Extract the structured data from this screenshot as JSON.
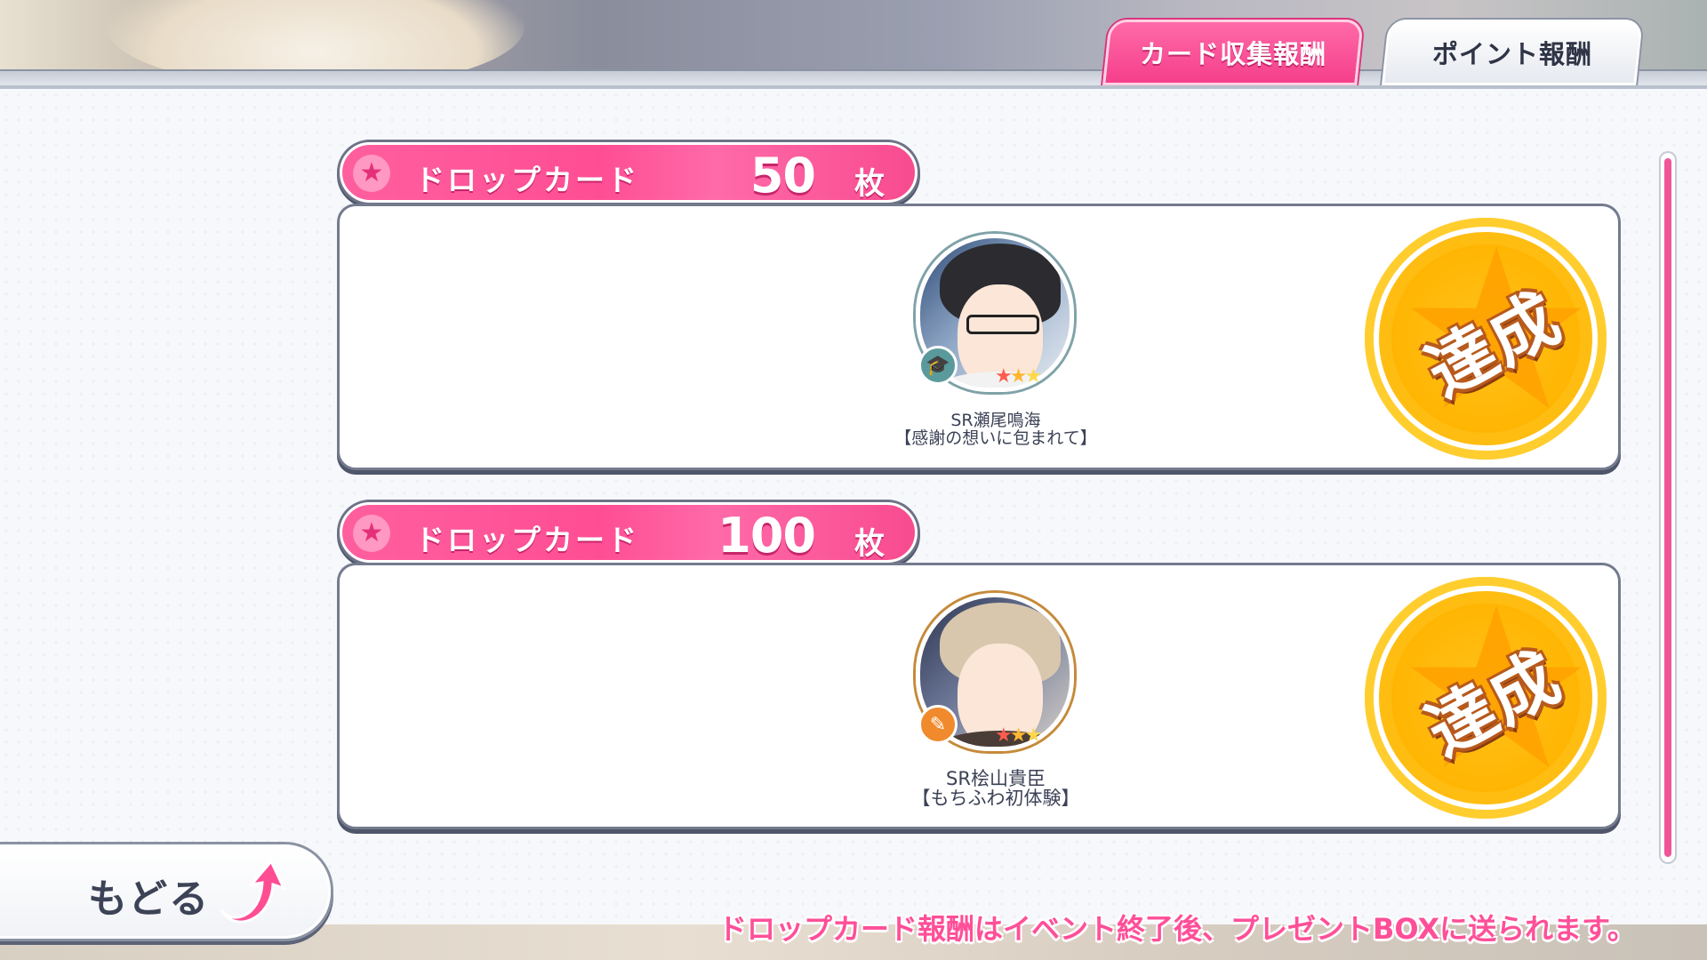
{
  "tabs": {
    "card_collection": "カード収集報酬",
    "point": "ポイント報酬"
  },
  "rewards": [
    {
      "header_label": "ドロップカード",
      "count": "50",
      "unit": "枚",
      "card_name": "SR瀬尾鳴海",
      "card_subtitle": "【感謝の想いに包まれて】",
      "stars": "★★★",
      "status": "達成"
    },
    {
      "header_label": "ドロップカード",
      "count": "100",
      "unit": "枚",
      "card_name": "SR桧山貴臣",
      "card_subtitle": "【もちふわ初体験】",
      "stars": "★★★",
      "status": "達成"
    }
  ],
  "back_button": "もどる",
  "notice": "ドロップカード報酬はイベント終了後、プレゼントBOXに送られます。",
  "colors": {
    "accent_pink": "#ff4d94",
    "medal_gold": "#ffb400",
    "text_dark": "#3c4256"
  },
  "icons": {
    "header": "star-icon",
    "card1_type": "graduation-cap-icon",
    "card2_type": "feather-icon",
    "back": "curved-arrow-icon"
  }
}
